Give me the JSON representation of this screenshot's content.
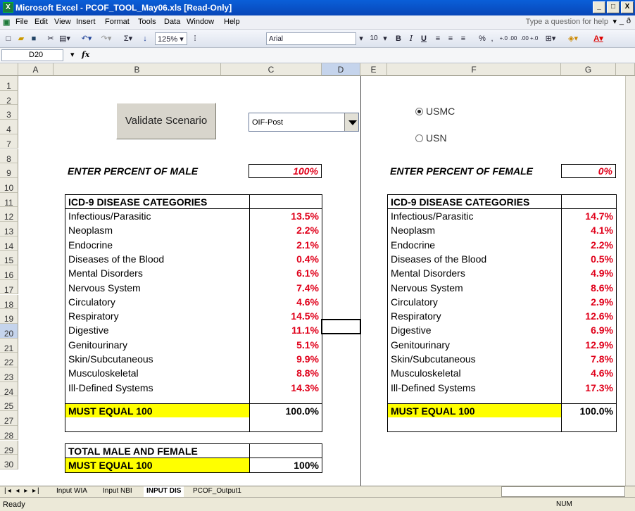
{
  "window": {
    "title": "Microsoft Excel - PCOF_TOOL_May06.xls  [Read-Only]",
    "minimize": "_",
    "restore": "□",
    "close": "X"
  },
  "menu": {
    "items": [
      "File",
      "Edit",
      "View",
      "Insert",
      "Format",
      "Tools",
      "Data",
      "Window",
      "Help"
    ],
    "help_placeholder": "Type a question for help",
    "right_controls": [
      "▾",
      "_",
      "ð",
      "x"
    ]
  },
  "toolbar": {
    "zoom": "125%",
    "font": "Arial",
    "size": "10",
    "buttons": [
      "B",
      "I",
      "U"
    ],
    "percent": "%",
    "comma": ",",
    "inc_decimal": "+.0 .00",
    "dec_decimal": ".00 +.0"
  },
  "formula_bar": {
    "name_box": "D20",
    "fx": "fx",
    "value": ""
  },
  "columns": [
    "A",
    "B",
    "C",
    "D",
    "E",
    "F",
    "G"
  ],
  "rows": [
    "1",
    "2",
    "3",
    "4",
    "7",
    "8",
    "9",
    "10",
    "11",
    "12",
    "13",
    "14",
    "15",
    "16",
    "17",
    "18",
    "19",
    "20",
    "21",
    "22",
    "23",
    "24",
    "25",
    "27",
    "28",
    "29",
    "30"
  ],
  "active_cell": {
    "column": "D",
    "row": "20"
  },
  "controls": {
    "validate_button": "Validate Scenario",
    "scenario_select": "OIF-Post",
    "radio_usmc": "USMC",
    "radio_usn": "USN",
    "radio_selected": "USMC"
  },
  "male": {
    "prompt": "ENTER PERCENT OF MALE",
    "percent": "100%",
    "header": "ICD-9 DISEASE CATEGORIES",
    "rows": [
      {
        "category": "Infectious/Parasitic",
        "value": "13.5%"
      },
      {
        "category": "Neoplasm",
        "value": "2.2%"
      },
      {
        "category": "Endocrine",
        "value": "2.1%"
      },
      {
        "category": "Diseases of the Blood",
        "value": "0.4%"
      },
      {
        "category": "Mental Disorders",
        "value": "6.1%"
      },
      {
        "category": "Nervous System",
        "value": "7.4%"
      },
      {
        "category": "Circulatory",
        "value": "4.6%"
      },
      {
        "category": "Respiratory",
        "value": "14.5%"
      },
      {
        "category": "Digestive",
        "value": "11.1%"
      },
      {
        "category": "Genitourinary",
        "value": "5.1%"
      },
      {
        "category": "Skin/Subcutaneous",
        "value": "9.9%"
      },
      {
        "category": "Musculoskeletal",
        "value": "8.8%"
      },
      {
        "category": "Ill-Defined Systems",
        "value": "14.3%"
      }
    ],
    "total_label": "MUST EQUAL 100",
    "total_value": "100.0%"
  },
  "female": {
    "prompt": "ENTER PERCENT OF FEMALE",
    "percent": "0%",
    "header": "ICD-9 DISEASE CATEGORIES",
    "rows": [
      {
        "category": "Infectious/Parasitic",
        "value": "14.7%"
      },
      {
        "category": "Neoplasm",
        "value": "4.1%"
      },
      {
        "category": "Endocrine",
        "value": "2.2%"
      },
      {
        "category": "Diseases of the Blood",
        "value": "0.5%"
      },
      {
        "category": "Mental Disorders",
        "value": "4.9%"
      },
      {
        "category": "Nervous System",
        "value": "8.6%"
      },
      {
        "category": "Circulatory",
        "value": "2.9%"
      },
      {
        "category": "Respiratory",
        "value": "12.6%"
      },
      {
        "category": "Digestive",
        "value": "6.9%"
      },
      {
        "category": "Genitourinary",
        "value": "12.9%"
      },
      {
        "category": "Skin/Subcutaneous",
        "value": "7.8%"
      },
      {
        "category": "Musculoskeletal",
        "value": "4.6%"
      },
      {
        "category": "Ill-Defined Systems",
        "value": "17.3%"
      }
    ],
    "total_label": "MUST EQUAL 100",
    "total_value": "100.0%"
  },
  "combined": {
    "title": "TOTAL MALE AND FEMALE",
    "total_label": "MUST EQUAL 100",
    "total_value": "100%"
  },
  "sheet_tabs": [
    "Input WIA",
    "Input NBI",
    "INPUT DIS",
    "PCOF_Output1"
  ],
  "active_sheet": "INPUT DIS",
  "status": {
    "left": "Ready",
    "right": "NUM"
  },
  "colors": {
    "value_red": "#e0001a",
    "highlight_yellow": "#ffff00",
    "title_blue": "#0a5fd8"
  }
}
